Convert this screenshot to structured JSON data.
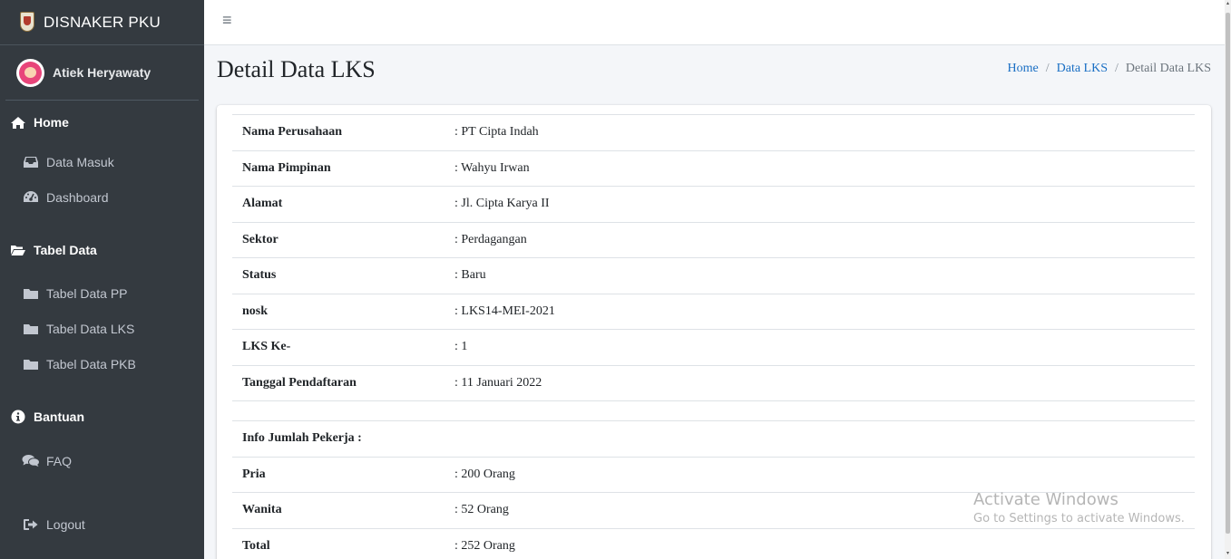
{
  "brand": {
    "title": "DISNAKER PKU"
  },
  "user": {
    "name": "Atiek Heryawaty"
  },
  "sidebar": {
    "sections": [
      {
        "header": "Home",
        "header_icon": "home-icon",
        "items": [
          {
            "label": "Data Masuk",
            "icon": "inbox-icon"
          },
          {
            "label": "Dashboard",
            "icon": "tachometer-icon"
          }
        ]
      },
      {
        "header": "Tabel Data",
        "header_icon": "folder-open-icon",
        "items": [
          {
            "label": "Tabel Data PP",
            "icon": "folder-icon"
          },
          {
            "label": "Tabel Data LKS",
            "icon": "folder-icon"
          },
          {
            "label": "Tabel Data PKB",
            "icon": "folder-icon"
          }
        ]
      },
      {
        "header": "Bantuan",
        "header_icon": "info-circle-icon",
        "items": [
          {
            "label": "FAQ",
            "icon": "comments-icon"
          }
        ]
      }
    ],
    "logout": {
      "label": "Logout",
      "icon": "sign-out-icon"
    }
  },
  "topbar": {
    "menu_icon": "hamburger-icon",
    "menu_glyph": "≡"
  },
  "page": {
    "title": "Detail Data LKS",
    "breadcrumb": [
      "Home",
      "Data LKS",
      "Detail Data LKS"
    ],
    "breadcrumb_sep": "/"
  },
  "details": {
    "rows": [
      {
        "label": "Nama Perusahaan",
        "value": ": PT Cipta Indah"
      },
      {
        "label": "Nama Pimpinan",
        "value": ": Wahyu Irwan"
      },
      {
        "label": "Alamat",
        "value": ": Jl. Cipta Karya II"
      },
      {
        "label": "Sektor",
        "value": ": Perdagangan"
      },
      {
        "label": "Status",
        "value": ": Baru"
      },
      {
        "label": "nosk",
        "value": ": LKS14-MEI-2021"
      },
      {
        "label": "LKS Ke-",
        "value": ": 1"
      },
      {
        "label": "Tanggal Pendaftaran",
        "value": ": 11 Januari 2022"
      }
    ],
    "workers_header": "Info Jumlah Pekerja :",
    "workers": [
      {
        "label": "Pria",
        "value": ": 200 Orang"
      },
      {
        "label": "Wanita",
        "value": ": 52 Orang"
      },
      {
        "label": "Total",
        "value": ": 252 Orang"
      }
    ]
  },
  "watermark": {
    "title": "Activate Windows",
    "subtitle": "Go to Settings to activate Windows."
  },
  "colors": {
    "sidebar_bg": "#343a40",
    "link": "#1a6fc4",
    "content_bg": "#f4f6f9"
  }
}
